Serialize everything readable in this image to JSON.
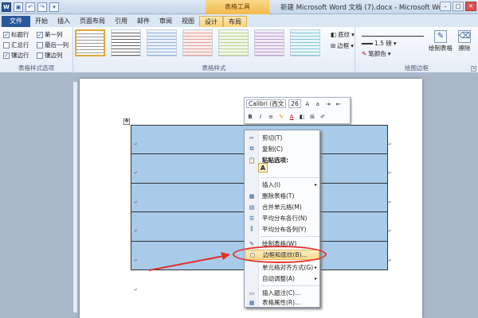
{
  "title_bar": {
    "context_group": "表格工具",
    "title": "新建 Microsoft Word 文档 (7).docx - Microsoft Word"
  },
  "tabs": [
    "文件",
    "开始",
    "插入",
    "页面布局",
    "引用",
    "邮件",
    "审阅",
    "视图",
    "设计",
    "布局"
  ],
  "ribbon": {
    "style_options": {
      "items": [
        {
          "label": "标题行",
          "checked": true
        },
        {
          "label": "第一列",
          "checked": true
        },
        {
          "label": "汇总行",
          "checked": false
        },
        {
          "label": "最后一列",
          "checked": false
        },
        {
          "label": "镶边行",
          "checked": true
        },
        {
          "label": "镶边列",
          "checked": false
        }
      ],
      "group_label": "表格样式选项"
    },
    "table_styles": {
      "group_label": "表格样式"
    },
    "shading_label": "底纹",
    "borders_label": "边框",
    "pen_weight": "1.5 磅",
    "pen_color_label": "笔颜色",
    "draw_table_label": "绘制表格",
    "eraser_label": "擦除",
    "draw_borders_group_label": "绘图边框"
  },
  "mini_toolbar": {
    "font": "Calibri (西文",
    "size": "26"
  },
  "context_menu": {
    "items": [
      {
        "icon": "scissors-icon",
        "glyph": "✂",
        "label": "剪切(T)"
      },
      {
        "icon": "copy-icon",
        "glyph": "⧉",
        "label": "复制(C)"
      },
      {
        "icon": "paste-icon",
        "glyph": "📋",
        "label": "粘贴选项:"
      },
      {
        "icon": "insert-icon",
        "glyph": "",
        "label": "插入(I)",
        "submenu": true
      },
      {
        "icon": "delete-table-icon",
        "glyph": "▦",
        "label": "删除表格(T)"
      },
      {
        "icon": "merge-cells-icon",
        "glyph": "▤",
        "label": "合并单元格(M)"
      },
      {
        "icon": "distribute-rows-icon",
        "glyph": "☰",
        "label": "平均分布各行(N)"
      },
      {
        "icon": "distribute-columns-icon",
        "glyph": "⫼",
        "label": "平均分布各列(Y)"
      },
      {
        "icon": "draw-table-icon",
        "glyph": "✎",
        "label": "绘制表格(W)"
      },
      {
        "icon": "borders-shading-icon",
        "glyph": "▢",
        "label": "边框和底纹(B)...",
        "highlighted": true
      },
      {
        "icon": "cell-alignment-icon",
        "glyph": "",
        "label": "单元格对齐方式(G)",
        "submenu": true
      },
      {
        "icon": "autofit-icon",
        "glyph": "",
        "label": "自动调整(A)",
        "submenu": true
      },
      {
        "icon": "insert-caption-icon",
        "glyph": "▭",
        "label": "插入题注(C)..."
      },
      {
        "icon": "table-properties-icon",
        "glyph": "▦",
        "label": "表格属性(R)..."
      }
    ],
    "paste_option_glyph": "A"
  },
  "colors": {
    "table_fill": "#a9cbea",
    "highlight_oval": "#e0302a",
    "file_tab": "#2b579a"
  }
}
